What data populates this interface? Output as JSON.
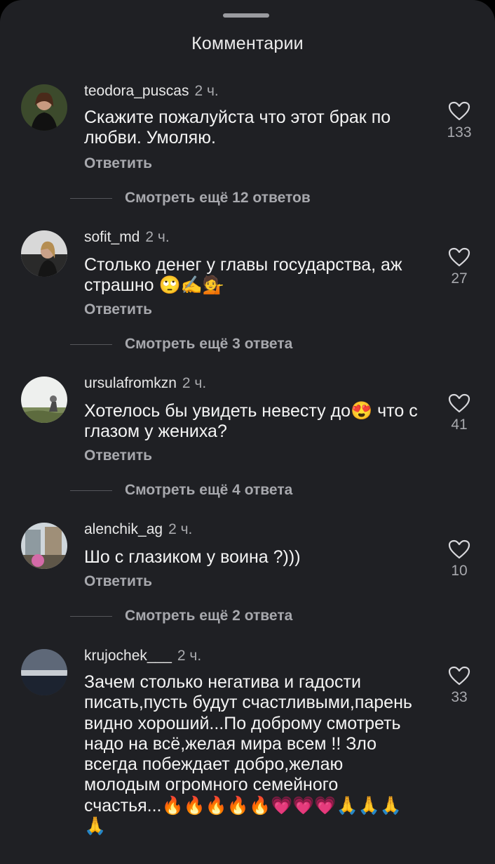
{
  "header": {
    "title": "Комментарии"
  },
  "comments": [
    {
      "username": "teodora_puscas",
      "time": "2 ч.",
      "text": "Скажите пожалуйста что этот брак по любви. Умоляю.",
      "reply_label": "Ответить",
      "likes": "133",
      "more_replies": "Смотреть ещё 12 ответов"
    },
    {
      "username": "sofit_md",
      "time": "2 ч.",
      "text": "Столько денег у главы государства, аж страшно 🙄✍💁",
      "reply_label": "Ответить",
      "likes": "27",
      "more_replies": "Смотреть ещё 3 ответа"
    },
    {
      "username": "ursulafromkzn",
      "time": "2 ч.",
      "text": "Хотелось бы увидеть невесту до😍 что с глазом у жениха?",
      "reply_label": "Ответить",
      "likes": "41",
      "more_replies": "Смотреть ещё 4 ответа"
    },
    {
      "username": "alenchik_ag",
      "time": "2 ч.",
      "text": "Шо с глазиком у воина ?)))",
      "reply_label": "Ответить",
      "likes": "10",
      "more_replies": "Смотреть ещё 2 ответа"
    },
    {
      "username": "krujochek___",
      "time": "2 ч.",
      "text": "Зачем столько негатива и гадости писать,пусть будут счастливыми,парень видно хороший...По доброму смотреть надо на всё,желая мира всем !! Зло всегда побеждает добро,желаю молодым огромного семейного счастья...🔥🔥🔥🔥🔥💗💗💗🙏🙏🙏🙏",
      "likes": "33"
    }
  ],
  "icons": {
    "like": "heart-outline-icon"
  },
  "colors": {
    "sheet_bg": "#1f2024",
    "secondary_text": "#a7a8ad"
  }
}
